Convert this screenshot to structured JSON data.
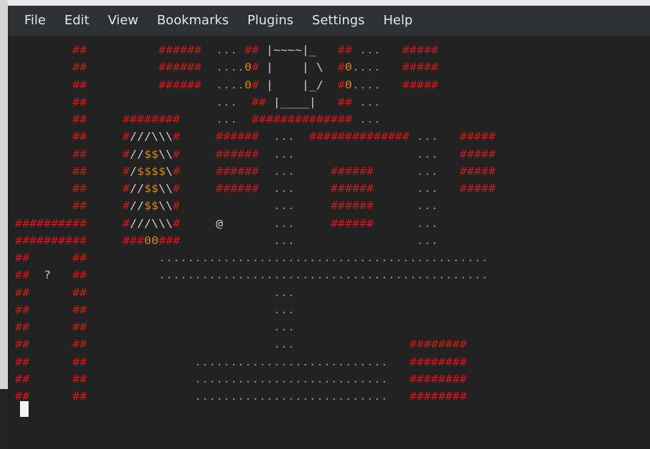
{
  "menu": {
    "items": [
      "File",
      "Edit",
      "View",
      "Bookmarks",
      "Plugins",
      "Settings",
      "Help"
    ]
  },
  "terminal": {
    "screen": [
      "         ##          ######  ... ## |~~~~|_   ## ...   #####",
      "         ##          ######  ....0# |    | \\  #0....   #####",
      "         ##          ######  ....0# |    |_/  #0....   #####",
      "         ##                  ...  ## |____|   ## ...",
      "         ##     ########     ...  ############## ...",
      "         ##     #///\\\\\\#     ######  ...  ############## ...   #####",
      "         ##     #//$$\\\\#     ######  ...                 ...   #####",
      "         ##     #/$$$$\\#     ######  ...     ######      ...   #####",
      "         ##     #//$$\\\\#     ######  ...     ######      ...   #####",
      "         ##     #//$$\\\\#             ...     ######      ...",
      " ##########     #///\\\\\\#     @       ...     ######      ...",
      " ##########     ###00###             ...                 ...",
      " ##      ##          ..............................................",
      " ##  ?   ##          ..............................................",
      " ##      ##                          ...",
      " ##      ##                          ...",
      " ##      ##                          ...",
      " ##      ##                          ...                ########",
      " ##      ##               ...........................   ########",
      " ##      ##               ...........................   ########",
      " ##      ##               ...........................   ########"
    ],
    "colors": {
      "wall": "#cf1818",
      "gold": "#d48417",
      "text": "#c9c9c9",
      "background": "#222222",
      "menubar": "#2e3033"
    }
  }
}
